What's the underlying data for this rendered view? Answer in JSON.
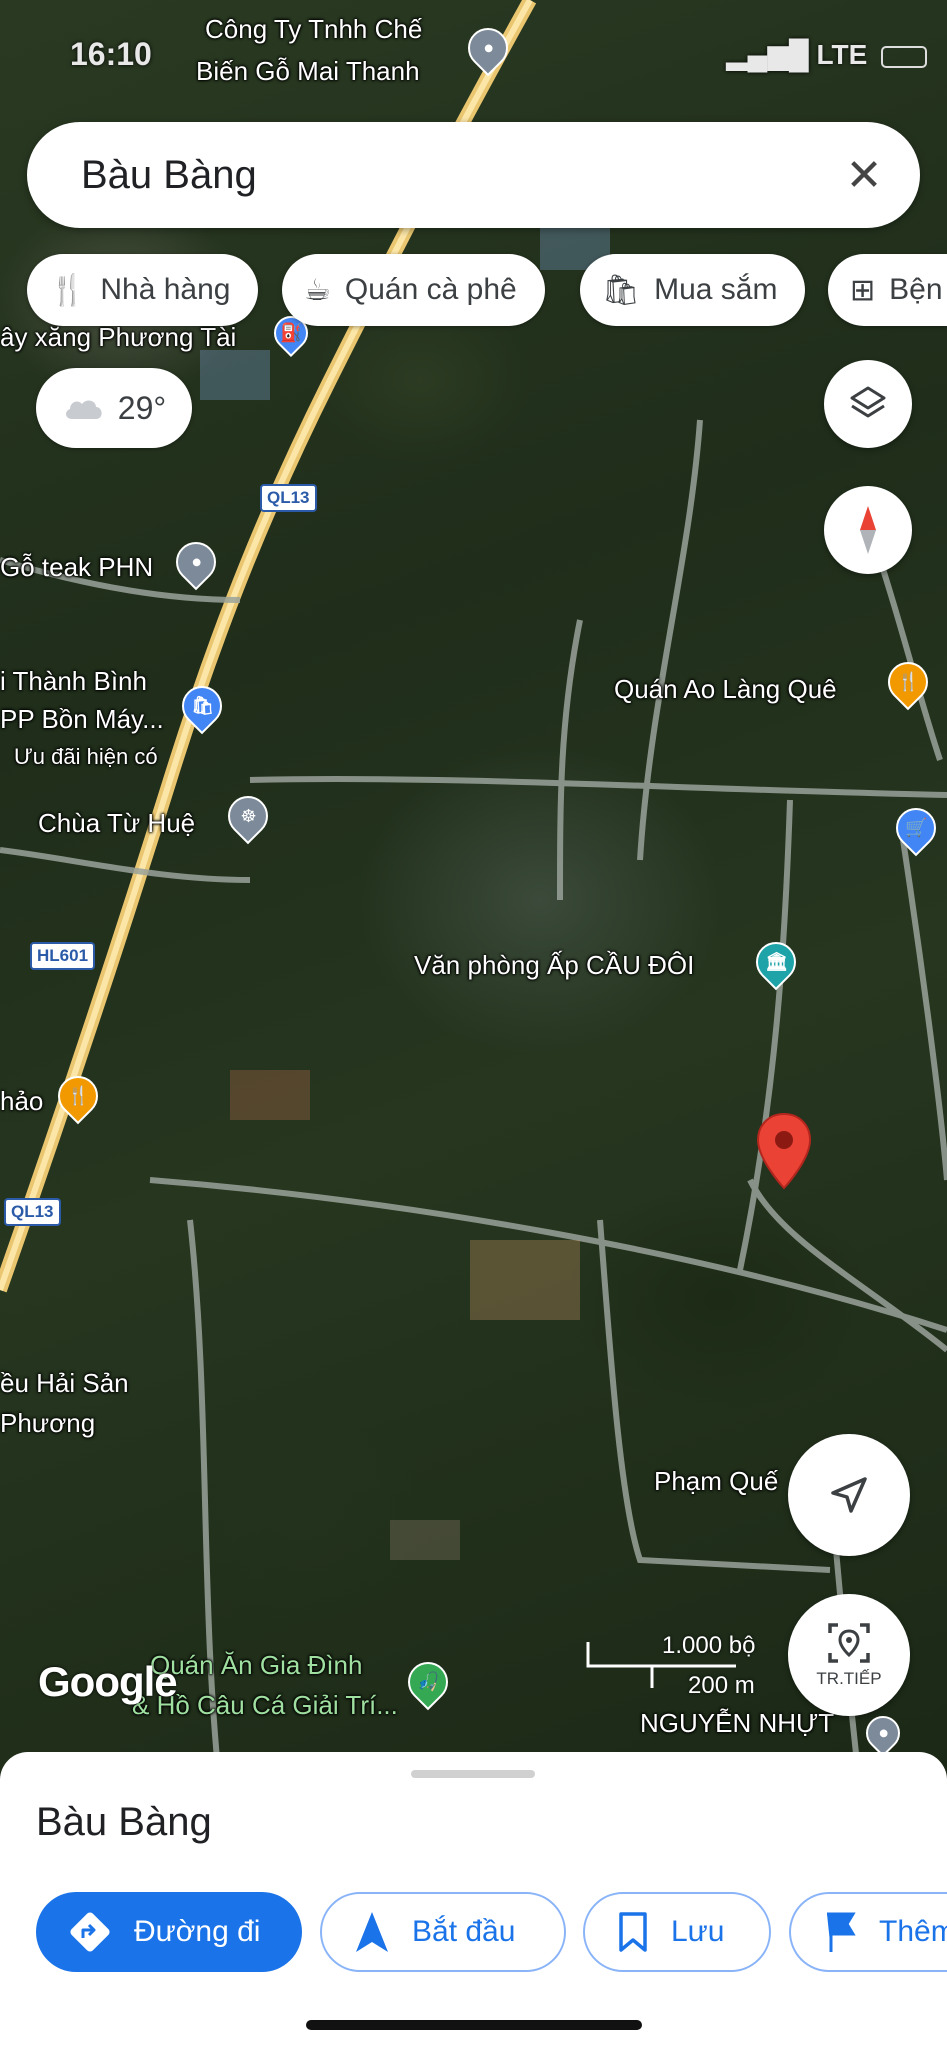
{
  "status_bar": {
    "time": "16:10",
    "network": "LTE"
  },
  "search": {
    "query": "Bàu Bàng"
  },
  "chips": [
    {
      "label": "Nhà hàng",
      "icon": "fork-knife-icon"
    },
    {
      "label": "Quán cà phê",
      "icon": "coffee-cup-icon"
    },
    {
      "label": "Mua sắm",
      "icon": "shopping-bag-icon"
    },
    {
      "label": "Bện",
      "icon": "hospital-plus-icon"
    }
  ],
  "weather": {
    "temperature": "29°",
    "icon": "cloud-icon"
  },
  "map_labels": {
    "road_1": "QL13",
    "road_2": "HL601",
    "road_3": "QL13",
    "poi_cong_ty_line1": "Công Ty Tnhh Chế",
    "poi_cong_ty_line2": "Biến Gỗ Mai Thanh",
    "poi_cay_xang": "ây xăng Phương Tài",
    "poi_go_teak": "Gỗ teak PHN",
    "poi_thanh_binh_line1": "i Thành Bình",
    "poi_thanh_binh_line2": "PP Bồn Máy...",
    "poi_uu_dai": "Ưu đãi hiện có",
    "poi_chua": "Chùa Từ Huệ",
    "poi_quan_ao_lang": "Quán Ao Làng Quê",
    "poi_van_phong": "Văn phòng Ấp CẦU ĐÔI",
    "poi_thao": "hảo",
    "poi_hai_san_line1": "ều Hải Sản",
    "poi_hai_san_line2": "Phương",
    "poi_pham_que": "Phạm Quế",
    "poi_quan_an_line1": "Quán Ăn Gia Đình",
    "poi_quan_an_line2": "& Hồ Câu Cá Giải Trí...",
    "poi_nguyen_nhut": "NGUYỄN NHỰT"
  },
  "scale": {
    "imperial": "1.000 bộ",
    "metric": "200 m"
  },
  "google_logo": "Google",
  "start_button": {
    "label": "TR.TIẾP"
  },
  "sheet": {
    "title": "Bàu Bàng",
    "actions": [
      {
        "label": "Đường đi",
        "icon": "directions-icon"
      },
      {
        "label": "Bắt đầu",
        "icon": "navigation-arrow-icon"
      },
      {
        "label": "Lưu",
        "icon": "bookmark-icon"
      },
      {
        "label": "Thêm",
        "icon": "flag-icon"
      }
    ]
  },
  "colors": {
    "accent": "#1a73e8",
    "pin_red": "#ea4335",
    "road_yellow": "#f2d27a",
    "poi_blue": "#4285f4",
    "poi_orange": "#f29900",
    "poi_teal": "#1ea4a8",
    "poi_green": "#34a853"
  }
}
